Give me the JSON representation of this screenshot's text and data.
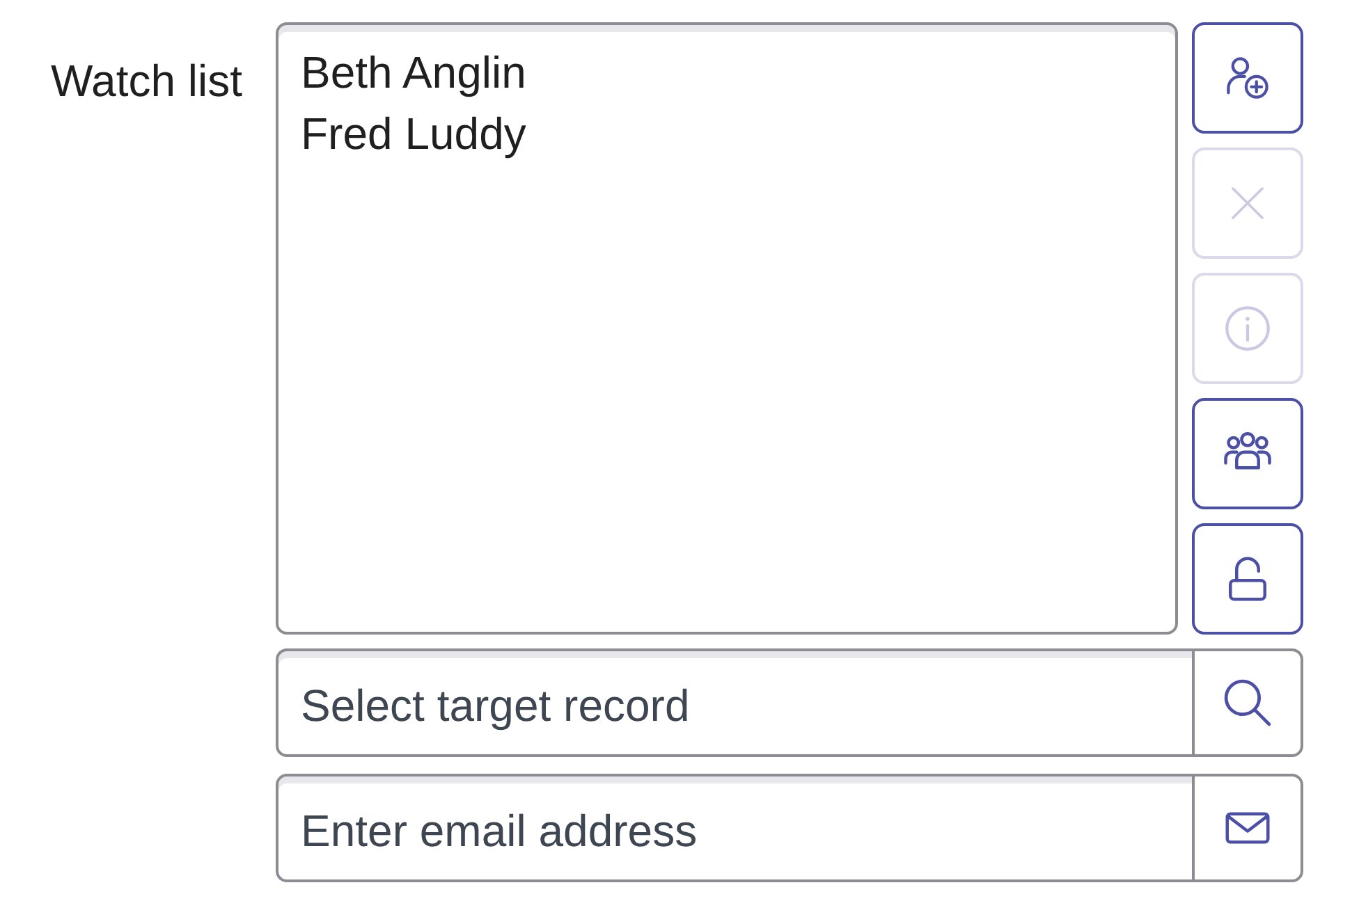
{
  "field_label": "Watch list",
  "watch_list": {
    "items": [
      {
        "name": "Beth Anglin",
        "selected": false
      },
      {
        "name": "Fred Luddy",
        "selected": false
      }
    ]
  },
  "side_buttons": [
    {
      "kind": "add_user",
      "disabled": false
    },
    {
      "kind": "remove",
      "disabled": true
    },
    {
      "kind": "info",
      "disabled": true
    },
    {
      "kind": "group",
      "disabled": false
    },
    {
      "kind": "unlock",
      "disabled": false
    }
  ],
  "lookup_fields": [
    {
      "kind": "search",
      "placeholder": "Select target record"
    },
    {
      "kind": "email",
      "placeholder": "Enter email address"
    }
  ]
}
